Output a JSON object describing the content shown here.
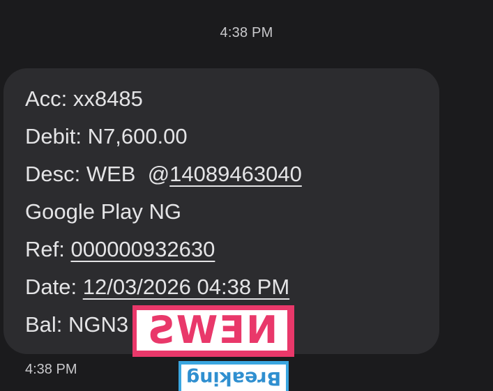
{
  "timestamp_top": "4:38 PM",
  "message": {
    "acc_line": "Acc: xx8485",
    "debit_line": "Debit: N7,600.00",
    "desc_prefix": "Desc: WEB  @",
    "desc_link": "14089463040",
    "merchant_line": "Google Play NG",
    "ref_prefix": "Ref: ",
    "ref_link": "000000932630",
    "date_prefix": "Date: ",
    "date_link": "12/03/2026 04:38 PM",
    "bal_line": "Bal: NGN3"
  },
  "timestamp_bottom": "4:38 PM",
  "sticker": {
    "top_text": "NEWS",
    "bottom_text": "Breaking"
  },
  "colors": {
    "background": "#1b1b1d",
    "bubble": "#2c2c2f",
    "text": "#e4e4e6",
    "sticker_pink": "#e9386a",
    "sticker_blue": "#3aa6e0"
  }
}
